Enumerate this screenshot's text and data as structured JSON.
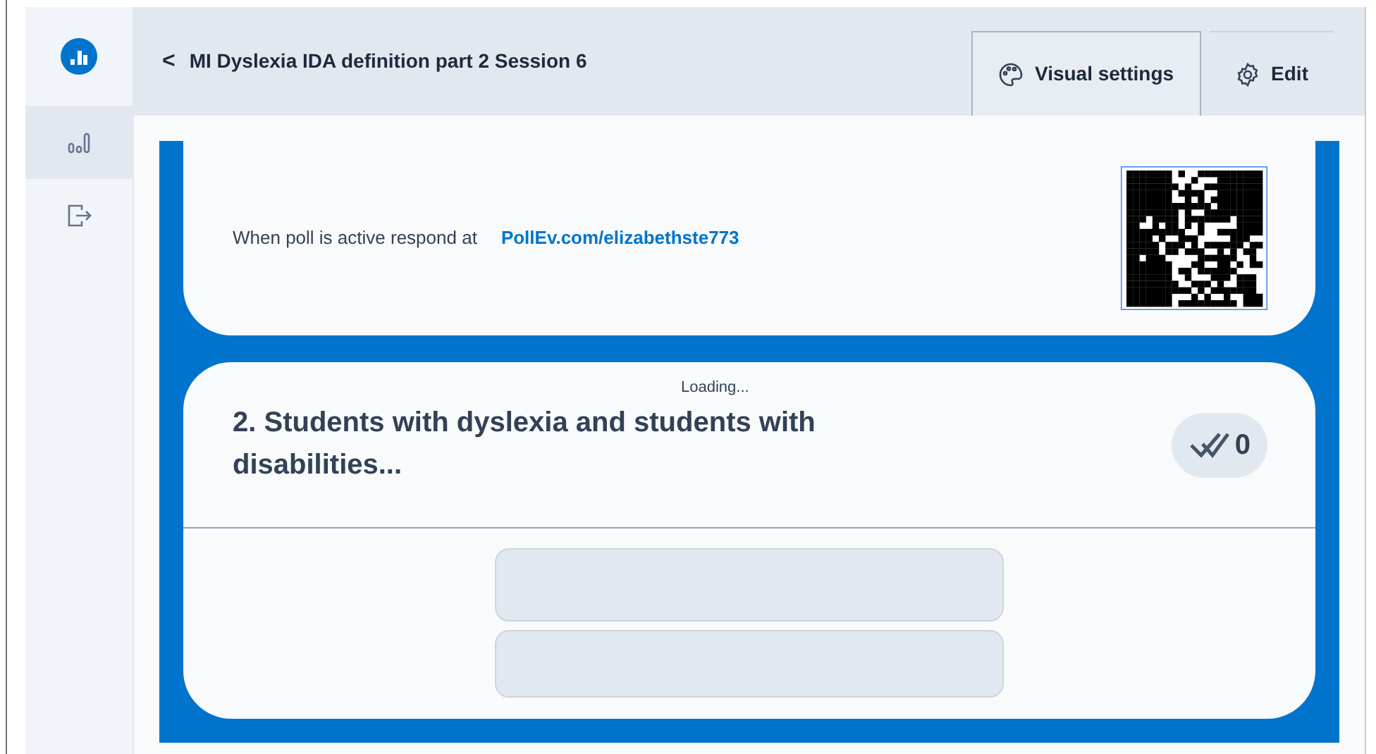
{
  "sidebar": {
    "items": [
      {
        "kind": "results",
        "selected": true
      },
      {
        "kind": "exit",
        "selected": false
      }
    ]
  },
  "header": {
    "back": "<",
    "title": "MI Dyslexia IDA definition part 2 Session 6",
    "buttons": [
      {
        "kind": "palette",
        "label": "Visual settings",
        "selected": true
      },
      {
        "kind": "gear",
        "label": "Edit",
        "selected": false
      }
    ]
  },
  "respond_card": {
    "text": "When poll is active respond at",
    "link": "PollEv.com/elizabethste773"
  },
  "question": {
    "title": "2. Students with dyslexia and students with disabilities...",
    "loading": "Loading...",
    "responses": "0"
  }
}
